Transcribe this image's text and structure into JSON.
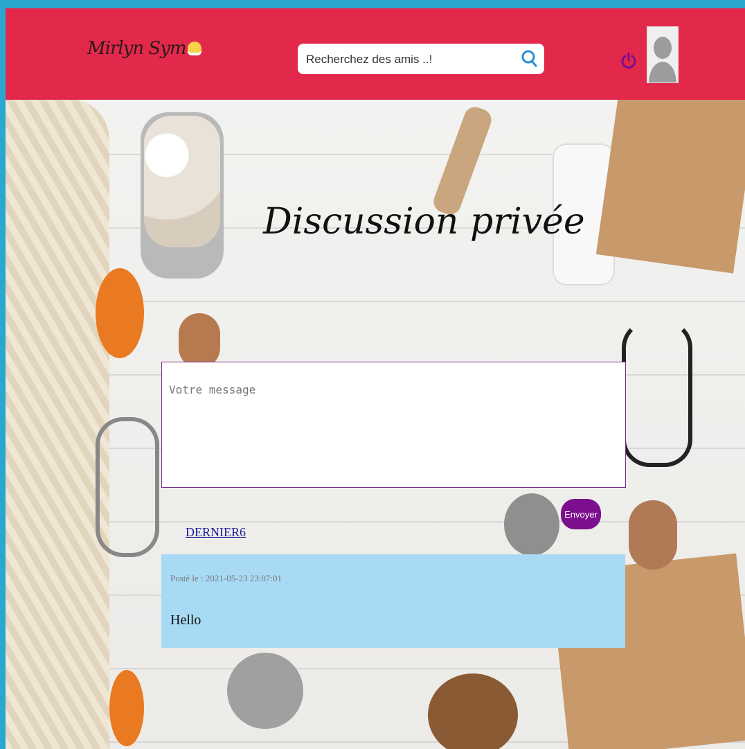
{
  "header": {
    "logo_text": "Mirlyn Sym",
    "search_placeholder": "Recherchez des amis ..!",
    "accent_color": "#e2294b"
  },
  "page": {
    "title": "Discussion privée"
  },
  "composer": {
    "placeholder": "Votre message",
    "send_label": "Envoyer",
    "send_color": "#7b0f8d"
  },
  "messages": [
    {
      "author": "DERNIER6",
      "date_label": "Posté le : 2021-05-23 23:07:01",
      "body": "Hello",
      "background": "#a8daf5"
    }
  ]
}
